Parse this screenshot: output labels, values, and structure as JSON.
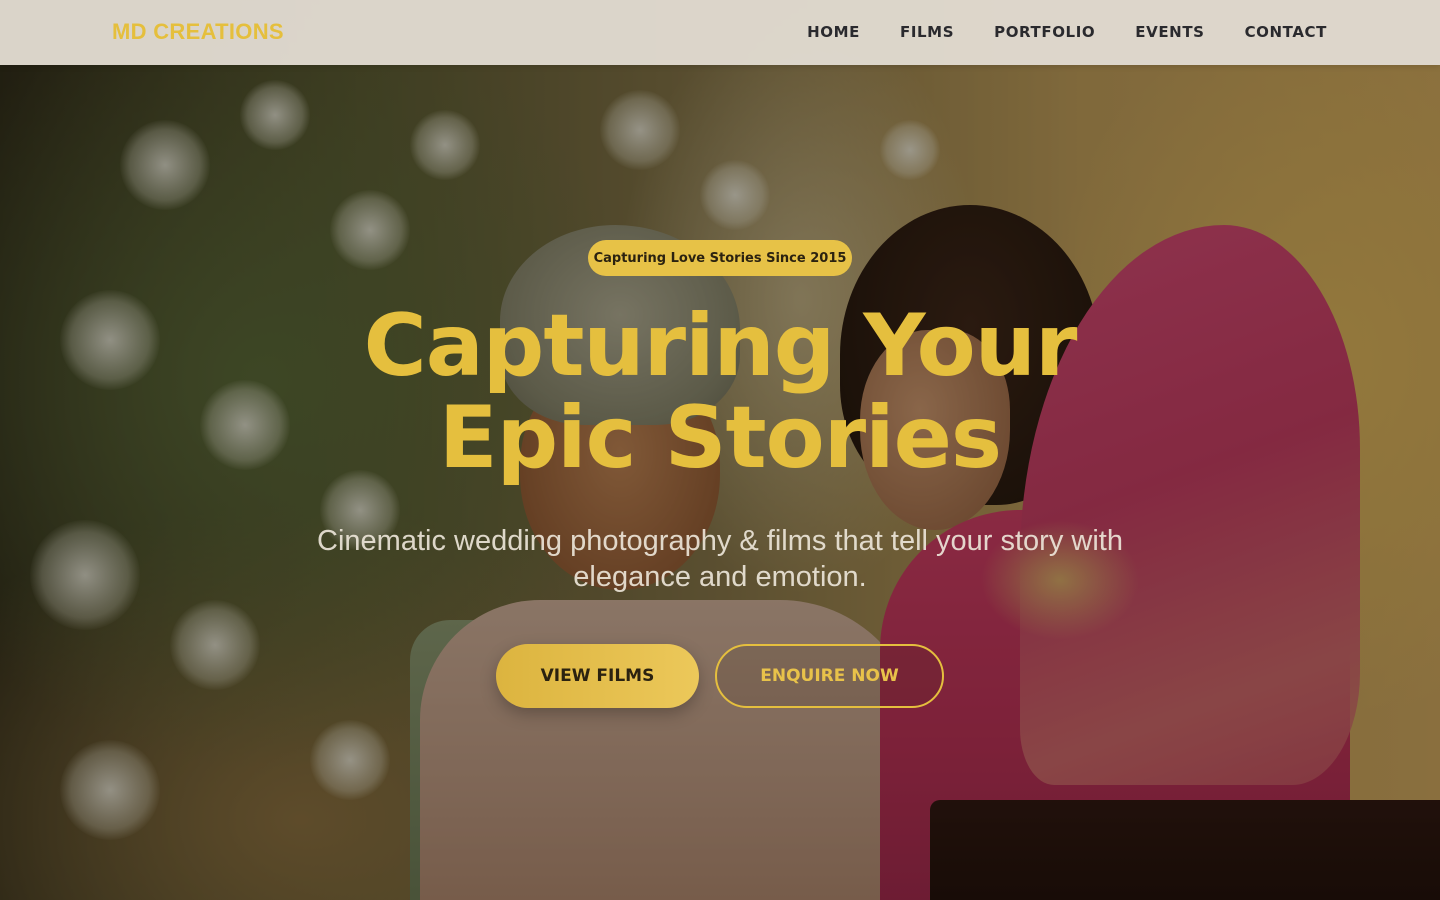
{
  "header": {
    "logo": "MD CREATIONS",
    "nav": [
      {
        "label": "HOME"
      },
      {
        "label": "FILMS"
      },
      {
        "label": "PORTFOLIO"
      },
      {
        "label": "EVENTS"
      },
      {
        "label": "CONTACT"
      }
    ]
  },
  "hero": {
    "badge": "Capturing Love Stories Since 2015",
    "title_line1": "Capturing Your",
    "title_line2": "Epic Stories",
    "subtitle_line1": "Cinematic wedding photography & films that tell your story with",
    "subtitle_line2": "elegance and emotion.",
    "primary_button": "VIEW FILMS",
    "secondary_button": "ENQUIRE NOW"
  },
  "colors": {
    "accent_gold": "#e5bf3e",
    "header_bg": "#e0dad0",
    "nav_text": "#2a2a2e"
  }
}
